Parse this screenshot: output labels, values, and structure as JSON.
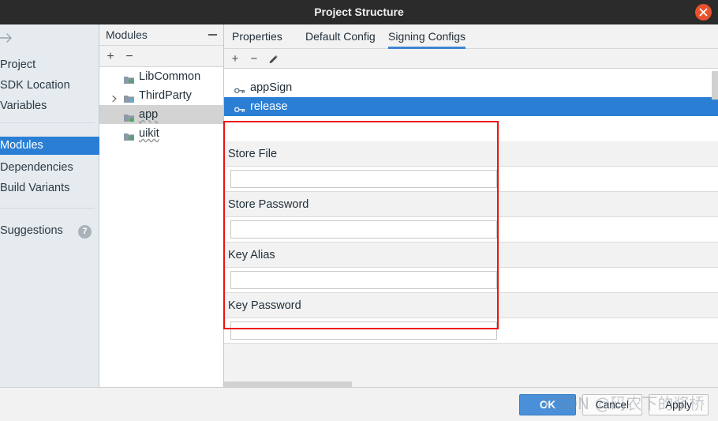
{
  "window": {
    "title": "Project Structure",
    "close_icon": "close-icon"
  },
  "left_nav": {
    "arrow_icon": "arrow-right-icon",
    "items": [
      {
        "label": "Project",
        "selected": false
      },
      {
        "label": "SDK Location",
        "selected": false
      },
      {
        "label": "Variables",
        "selected": false
      },
      {
        "label": "Modules",
        "selected": true
      },
      {
        "label": "Dependencies",
        "selected": false
      },
      {
        "label": "Build Variants",
        "selected": false
      },
      {
        "label": "Suggestions",
        "selected": false,
        "badge": "7"
      }
    ]
  },
  "modules_panel": {
    "title": "Modules",
    "minimize_icon": "minimize-icon",
    "toolbar": {
      "add_label": "+",
      "remove_label": "−"
    },
    "tree": [
      {
        "label": "LibCommon",
        "icon": "android-library-icon",
        "expandable": false,
        "selected": false,
        "squiggle": false
      },
      {
        "label": "ThirdParty",
        "icon": "module-group-icon",
        "expandable": true,
        "selected": false,
        "squiggle": false
      },
      {
        "label": "app",
        "icon": "android-app-icon",
        "expandable": false,
        "selected": true,
        "squiggle": true
      },
      {
        "label": "uikit",
        "icon": "android-library-icon",
        "expandable": false,
        "selected": false,
        "squiggle": true
      }
    ]
  },
  "main": {
    "tabs": [
      {
        "label": "Properties",
        "active": false
      },
      {
        "label": "Default Config",
        "active": false
      },
      {
        "label": "Signing Configs",
        "active": true
      }
    ],
    "configs_toolbar": {
      "add_label": "+",
      "remove_label": "−",
      "edit_icon": "pencil-icon"
    },
    "configs": [
      {
        "label": "appSign",
        "icon": "key-icon",
        "selected": false
      },
      {
        "label": "release",
        "icon": "key-icon",
        "selected": true
      }
    ],
    "form_fields": [
      {
        "label": "Store File",
        "value": "",
        "placeholder": ""
      },
      {
        "label": "Store Password",
        "value": "",
        "placeholder": ""
      },
      {
        "label": "Key Alias",
        "value": "",
        "placeholder": ""
      },
      {
        "label": "Key Password",
        "value": "",
        "placeholder": ""
      }
    ]
  },
  "buttons": {
    "ok": "OK",
    "cancel": "Cancel",
    "apply": "Apply"
  },
  "watermark": {
    "text": "CSDN @码农下的浆桥"
  },
  "colors": {
    "accent": "#2a7fd4",
    "titlebar": "#2b2b2b",
    "close": "#e8512b",
    "annotation": "#ee1111",
    "primary_button": "#4a90d9"
  }
}
